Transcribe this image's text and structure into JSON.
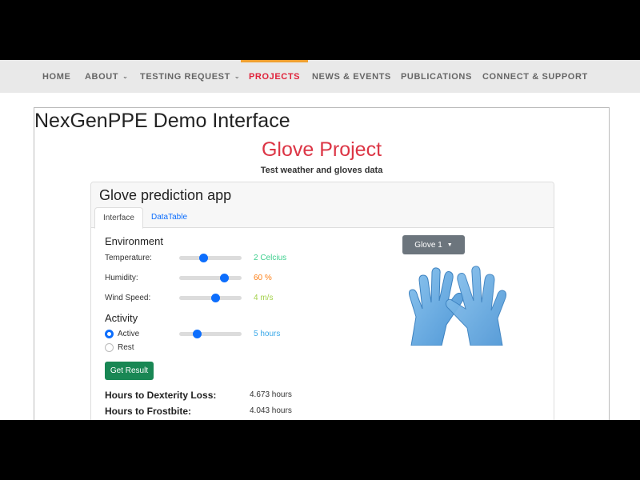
{
  "nav": {
    "items": [
      {
        "label": "HOME"
      },
      {
        "label": "ABOUT",
        "caret": "⌄"
      },
      {
        "label": "TESTING REQUEST",
        "caret": "⌄"
      },
      {
        "label": "PROJECTS"
      },
      {
        "label": "NEWS & EVENTS"
      },
      {
        "label": "PUBLICATIONS"
      },
      {
        "label": "CONNECT & SUPPORT"
      }
    ],
    "active_index": 3,
    "colors": {
      "active": "#e0223a",
      "accent_bar": "#f0a030",
      "text": "#666666"
    }
  },
  "page": {
    "app_title": "NexGenPPE Demo Interface",
    "project_title": "Glove Project",
    "project_subtitle": "Test weather and gloves data"
  },
  "card": {
    "title": "Glove prediction app",
    "tabs": [
      {
        "label": "Interface",
        "active": true
      },
      {
        "label": "DataTable",
        "active": false
      }
    ]
  },
  "environment": {
    "heading": "Environment",
    "temperature": {
      "label": "Temperature:",
      "value_text": "2 Celcius",
      "level": 0.38,
      "color": "#3ecf8e"
    },
    "humidity": {
      "label": "Humidity:",
      "value_text": "60 %",
      "level": 0.72,
      "color": "#fd7e14"
    },
    "wind_speed": {
      "label": "Wind Speed:",
      "value_text": "4 m/s",
      "level": 0.58,
      "color": "#a3d14b"
    }
  },
  "activity": {
    "heading": "Activity",
    "options": [
      {
        "label": "Active",
        "checked": true
      },
      {
        "label": "Rest",
        "checked": false
      }
    ],
    "duration": {
      "value_text": "5 hours",
      "level": 0.28,
      "color": "#3aa8e8"
    }
  },
  "actions": {
    "get_result_label": "Get Result"
  },
  "results": {
    "dexterity": {
      "label": "Hours to Dexterity Loss:",
      "value": "4.673 hours"
    },
    "frostbite": {
      "label": "Hours to Frostbite:",
      "value": "4.043 hours"
    }
  },
  "glove_select": {
    "selected": "Glove 1",
    "icon": "caret-down-icon"
  },
  "colors": {
    "primary": "#0d6efd",
    "success": "#198754",
    "secondary": "#6c757d",
    "danger": "#dc3545"
  }
}
